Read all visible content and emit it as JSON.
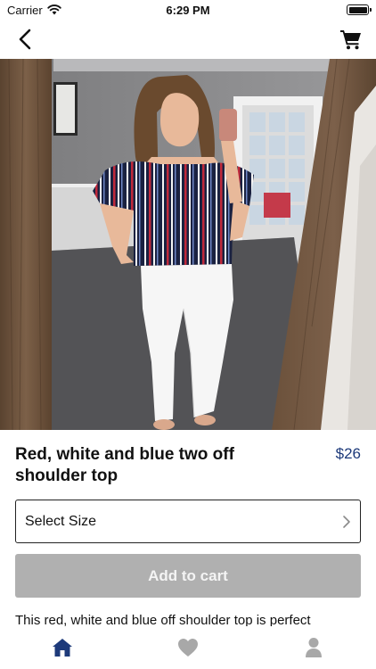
{
  "status_bar": {
    "carrier": "Carrier",
    "time": "6:29 PM",
    "icons": [
      "wifi-icon",
      "battery-icon"
    ]
  },
  "nav": {
    "back_icon": "chevron-left-icon",
    "cart_icon": "cart-icon"
  },
  "product": {
    "title": "Red, white and blue two off shoulder top",
    "price": "$26",
    "size_select_label": "Select Size",
    "size_select_icon": "chevron-right-icon",
    "add_to_cart_label": "Add to cart",
    "description": "This red, white and blue off shoulder top is perfect"
  },
  "tab_bar": {
    "items": [
      {
        "icon": "home-icon",
        "active": true
      },
      {
        "icon": "heart-icon",
        "active": false
      },
      {
        "icon": "profile-icon",
        "active": false
      }
    ]
  },
  "colors": {
    "accent": "#1d3a7a",
    "button_disabled": "#b0b0b0",
    "tab_inactive": "#a8a8a8"
  }
}
